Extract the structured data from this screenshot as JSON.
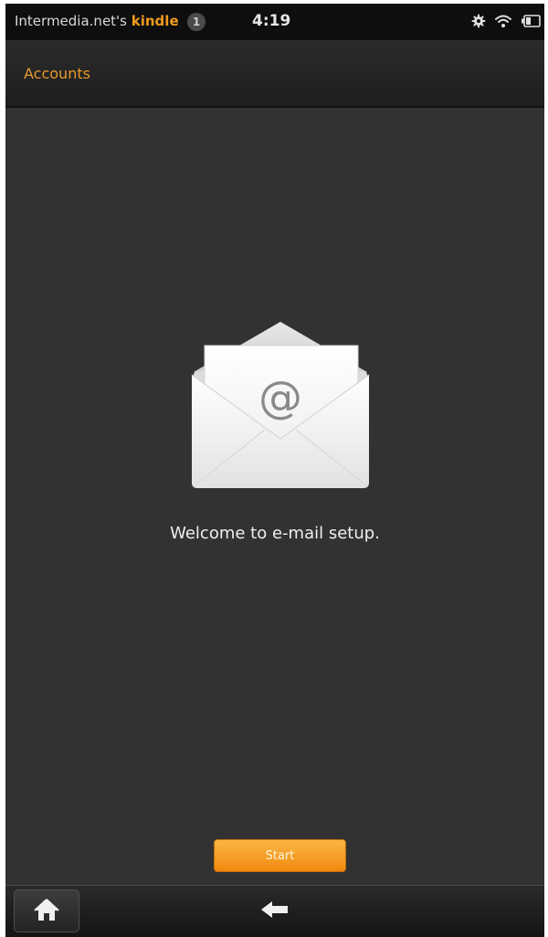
{
  "status_bar": {
    "owner_prefix": "Intermedia.net's ",
    "device_name": "kindle",
    "notification_count": "1",
    "time": "4:19",
    "icons": [
      "settings-gear-icon",
      "wifi-icon",
      "battery-icon"
    ]
  },
  "title_bar": {
    "title": "Accounts"
  },
  "main": {
    "illustration": "envelope-at-icon",
    "at_symbol": "@",
    "welcome_text": "Welcome to e-mail setup.",
    "start_label": "Start"
  },
  "bottom_nav": {
    "icons": [
      "home-icon",
      "back-arrow-icon"
    ]
  },
  "colors": {
    "accent": "#f09a1e",
    "background": "#323232",
    "button_top": "#fbb646",
    "button_bottom": "#f08a0e"
  }
}
